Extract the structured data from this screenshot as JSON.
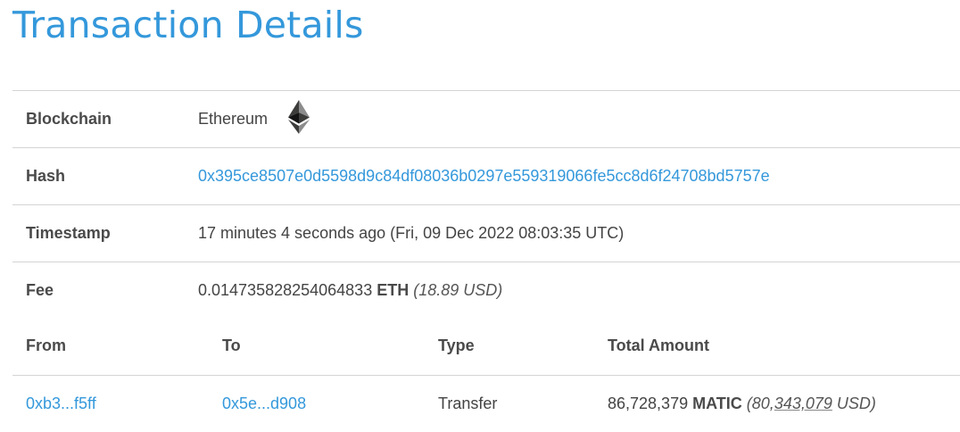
{
  "page": {
    "title": "Transaction Details"
  },
  "details": {
    "blockchain": {
      "label": "Blockchain",
      "value": "Ethereum",
      "icon": "ethereum-icon"
    },
    "hash": {
      "label": "Hash",
      "value": "0x395ce8507e0d5598d9c84df08036b0297e559319066fe5cc8d6f24708bd5757e"
    },
    "timestamp": {
      "label": "Timestamp",
      "value": "17 minutes 4 seconds ago (Fri, 09 Dec 2022 08:03:35 UTC)"
    },
    "fee": {
      "label": "Fee",
      "amount": "0.014735828254064833",
      "unit": "ETH",
      "usd": "(18.89 USD)"
    }
  },
  "transfers": {
    "headers": {
      "from": "From",
      "to": "To",
      "type": "Type",
      "total": "Total Amount"
    },
    "rows": [
      {
        "from": "0xb3...f5ff",
        "to": "0x5e...d908",
        "type": "Transfer",
        "amount": "86,728,379",
        "unit": "MATIC",
        "usd_pre": "(80,",
        "usd_ul": "343,079",
        "usd_post": " USD)"
      }
    ]
  },
  "colors": {
    "accent": "#3498db",
    "divider": "#d4d4d4",
    "text": "#444444"
  }
}
